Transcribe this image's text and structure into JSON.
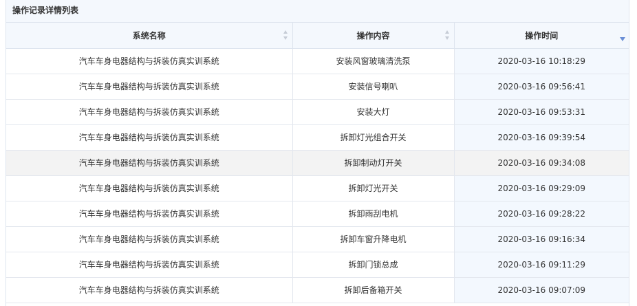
{
  "panel": {
    "title": "操作记录详情列表"
  },
  "table": {
    "columns": [
      {
        "label": "系统名称",
        "sort": "none"
      },
      {
        "label": "操作内容",
        "sort": "none"
      },
      {
        "label": "操作时间",
        "sort": "desc"
      }
    ],
    "rows": [
      {
        "system": "汽车车身电器结构与拆装仿真实训系统",
        "operation": "安装风窗玻璃清洗泵",
        "time": "2020-03-16 10:18:29"
      },
      {
        "system": "汽车车身电器结构与拆装仿真实训系统",
        "operation": "安装信号喇叭",
        "time": "2020-03-16 09:56:41"
      },
      {
        "system": "汽车车身电器结构与拆装仿真实训系统",
        "operation": "安装大灯",
        "time": "2020-03-16 09:53:31"
      },
      {
        "system": "汽车车身电器结构与拆装仿真实训系统",
        "operation": "拆卸灯光组合开关",
        "time": "2020-03-16 09:39:54"
      },
      {
        "system": "汽车车身电器结构与拆装仿真实训系统",
        "operation": "拆卸制动灯开关",
        "time": "2020-03-16 09:34:08"
      },
      {
        "system": "汽车车身电器结构与拆装仿真实训系统",
        "operation": "拆卸灯光开关",
        "time": "2020-03-16 09:29:09"
      },
      {
        "system": "汽车车身电器结构与拆装仿真实训系统",
        "operation": "拆卸雨刮电机",
        "time": "2020-03-16 09:28:22"
      },
      {
        "system": "汽车车身电器结构与拆装仿真实训系统",
        "operation": "拆卸车窗升降电机",
        "time": "2020-03-16 09:16:34"
      },
      {
        "system": "汽车车身电器结构与拆装仿真实训系统",
        "operation": "拆卸门锁总成",
        "time": "2020-03-16 09:11:29"
      },
      {
        "system": "汽车车身电器结构与拆装仿真实训系统",
        "operation": "拆卸后备箱开关",
        "time": "2020-03-16 09:07:09"
      }
    ],
    "hovered_row_index": 4
  },
  "colors": {
    "header_bg": "#f4f8fd",
    "border": "#dde4ee",
    "sorted_column_bg": "#f3f8fe",
    "hover_row_bg": "#f3f3f3",
    "sort_active": "#6b8fd6",
    "sort_inactive": "#c6ccd6"
  },
  "icons": {
    "sort_inactive": "sort-both-icon",
    "sort_active": "sort-desc-icon"
  }
}
